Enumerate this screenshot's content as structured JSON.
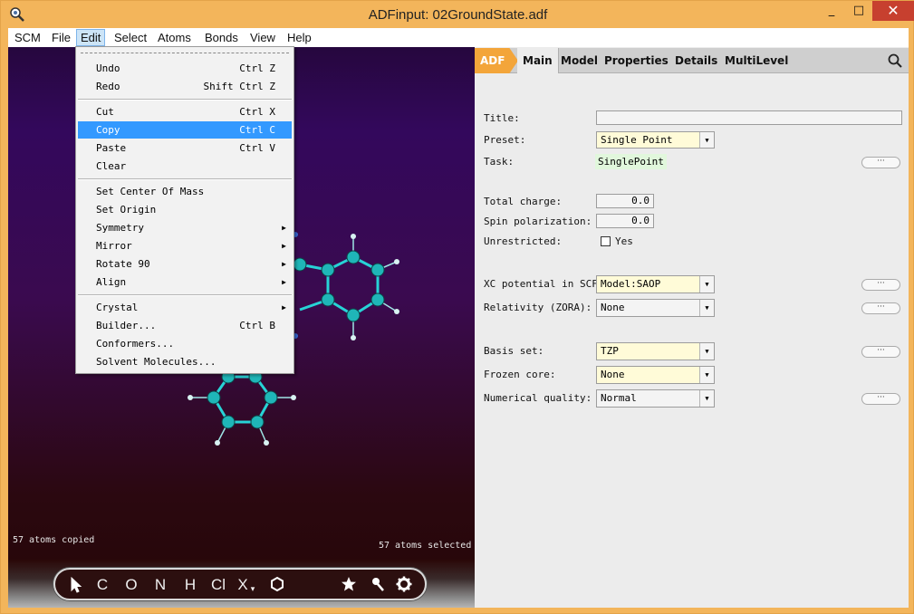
{
  "window": {
    "title": "ADFinput: 02GroundState.adf",
    "minimize": "_",
    "maximize": "□",
    "close": "✕"
  },
  "menubar": [
    "SCM",
    "File",
    "Edit",
    "Select",
    "Atoms",
    "Bonds",
    "View",
    "Help"
  ],
  "edit_menu": {
    "items": [
      {
        "label": "Undo",
        "shortcut": "Ctrl Z"
      },
      {
        "label": "Redo",
        "shortcut": "Shift Ctrl Z"
      },
      {
        "label": "Cut",
        "shortcut": "Ctrl X"
      },
      {
        "label": "Copy",
        "shortcut": "Ctrl C",
        "highlighted": true
      },
      {
        "label": "Paste",
        "shortcut": "Ctrl V"
      },
      {
        "label": "Clear",
        "shortcut": ""
      },
      {
        "label": "Set Center Of Mass",
        "shortcut": ""
      },
      {
        "label": "Set Origin",
        "shortcut": ""
      },
      {
        "label": "Symmetry",
        "shortcut": "",
        "submenu": true
      },
      {
        "label": "Mirror",
        "shortcut": "",
        "submenu": true
      },
      {
        "label": "Rotate 90",
        "shortcut": "",
        "submenu": true
      },
      {
        "label": "Align",
        "shortcut": "",
        "submenu": true
      },
      {
        "label": "Crystal",
        "shortcut": "",
        "submenu": true
      },
      {
        "label": "Builder...",
        "shortcut": "Ctrl B"
      },
      {
        "label": "Conformers...",
        "shortcut": ""
      },
      {
        "label": "Solvent Molecules...",
        "shortcut": ""
      }
    ]
  },
  "viewport": {
    "status_left": "57 atoms copied",
    "status_right": "57 atoms selected"
  },
  "toolbar": {
    "C": "C",
    "O": "O",
    "N": "N",
    "H": "H",
    "Cl": "Cl",
    "X": "X",
    "X_sub": "▾"
  },
  "panel": {
    "tabs": {
      "adf": "ADF",
      "main": "Main",
      "model": "Model",
      "properties": "Properties",
      "details": "Details",
      "multilevel": "MultiLevel"
    },
    "title_label": "Title:",
    "title_value": "",
    "preset_label": "Preset:",
    "preset_value": "Single Point",
    "task_label": "Task:",
    "task_value": "SinglePoint",
    "total_charge_label": "Total charge:",
    "total_charge_value": "0.0",
    "spin_label": "Spin polarization:",
    "spin_value": "0.0",
    "unrestricted_label": "Unrestricted:",
    "unrestricted_option": "Yes",
    "unrestricted_checked": false,
    "xc_label": "XC potential in SCF:",
    "xc_value": "Model:SAOP",
    "relativity_label": "Relativity (ZORA):",
    "relativity_value": "None",
    "basis_label": "Basis set:",
    "basis_value": "TZP",
    "frozen_label": "Frozen core:",
    "frozen_value": "None",
    "numq_label": "Numerical quality:",
    "numq_value": "Normal",
    "more_button": "···"
  }
}
